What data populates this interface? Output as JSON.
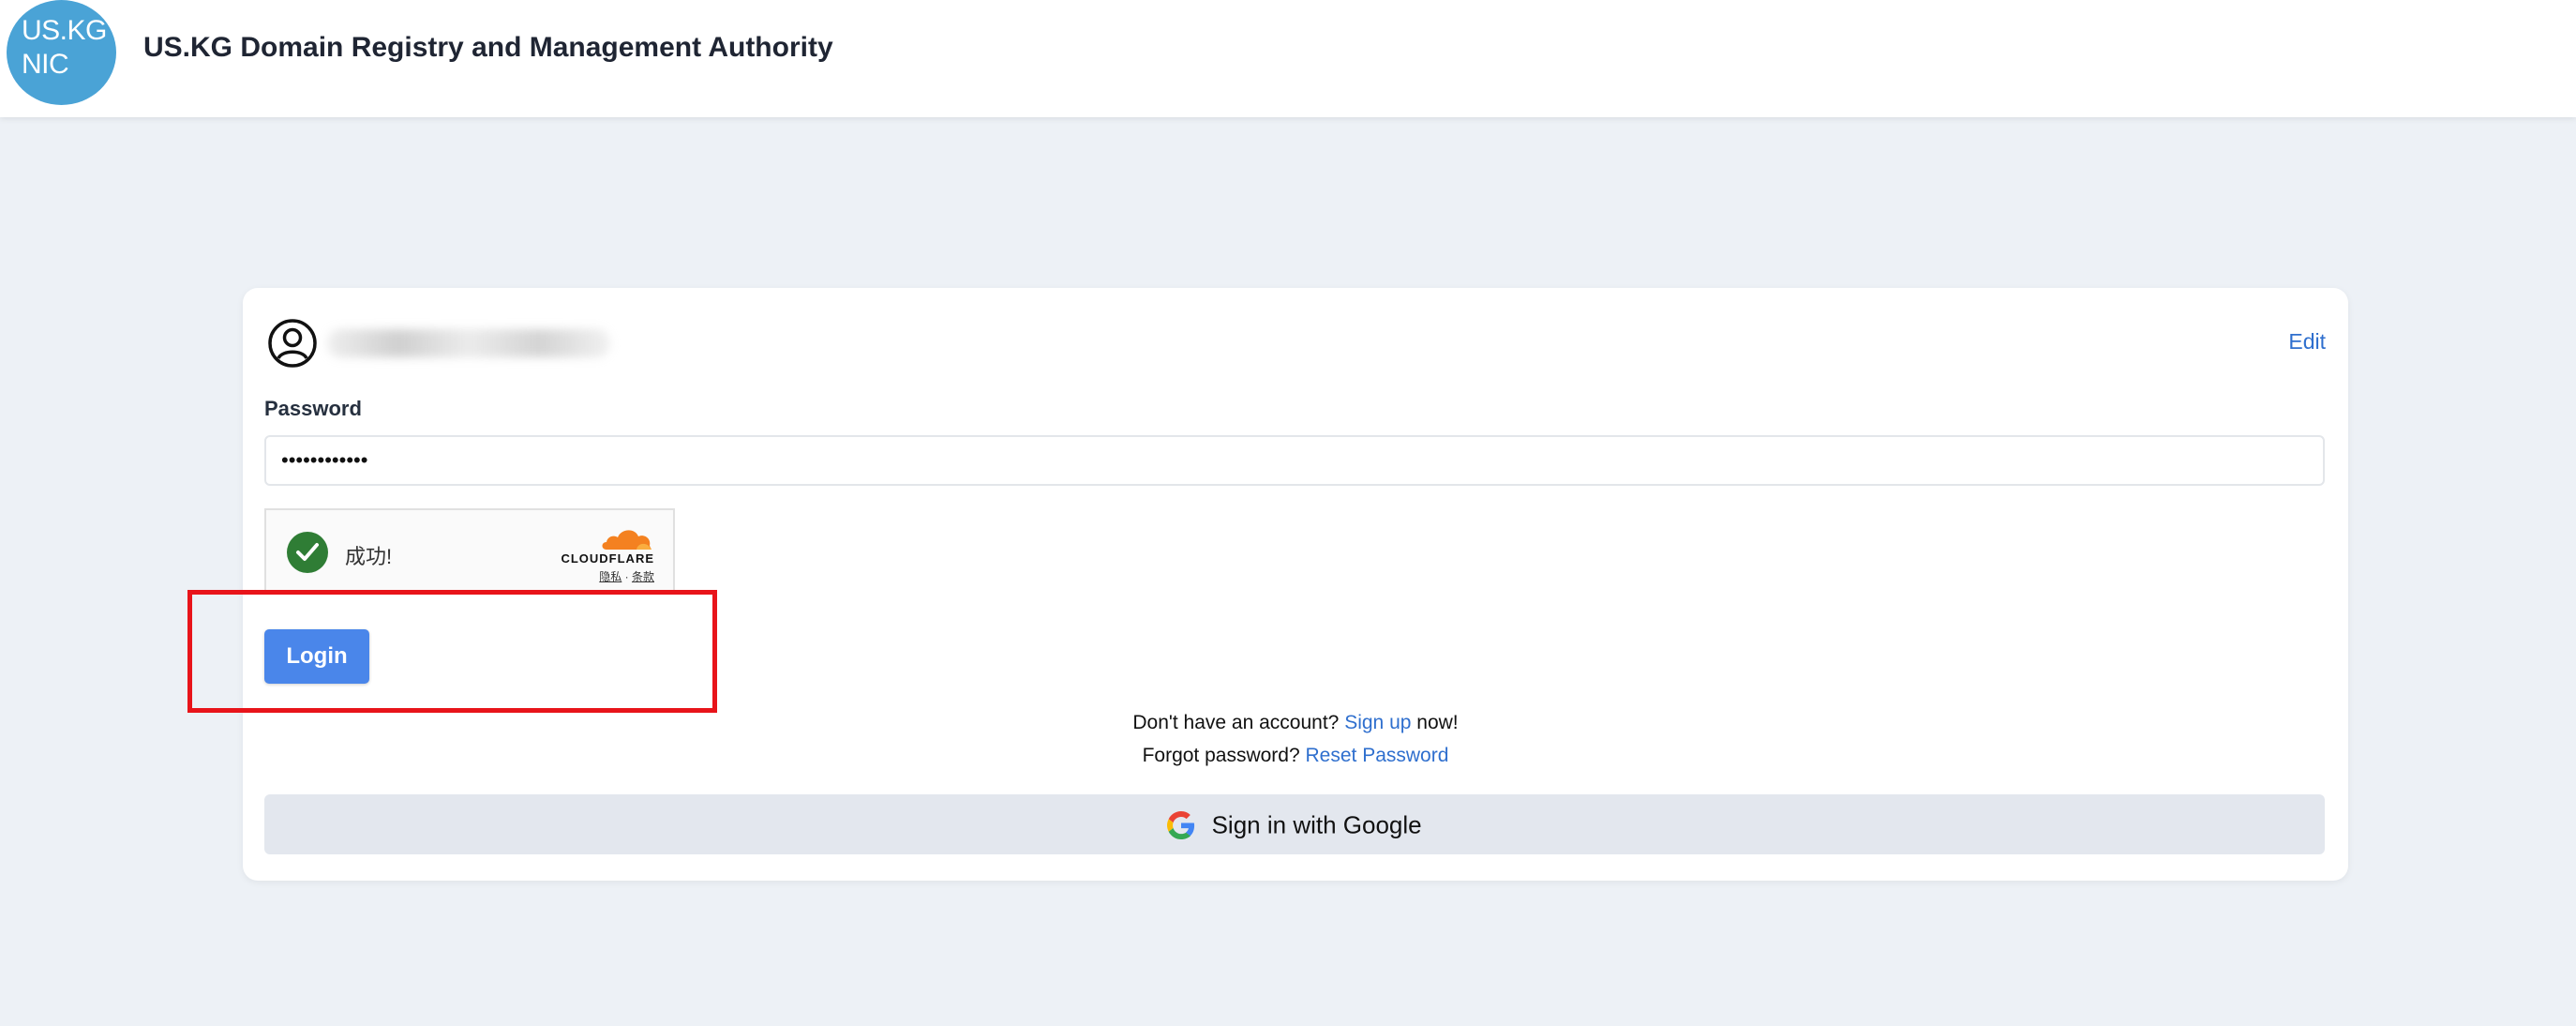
{
  "header": {
    "logo_line1": "US.KG",
    "logo_line2": "NIC",
    "title": "US.KG Domain Registry and Management Authority"
  },
  "login_card": {
    "edit_label": "Edit",
    "password_label": "Password",
    "password_value": "••••••••••••",
    "captcha": {
      "status_text": "成功!",
      "brand": "CLOUDFLARE",
      "privacy_link": "隐私",
      "separator": "·",
      "terms_link": "条款"
    },
    "login_label": "Login",
    "signup_prefix": "Don't have an account?",
    "signup_link": "Sign up",
    "signup_suffix": "now!",
    "forgot_prefix": "Forgot password?",
    "reset_link": "Reset Password",
    "google_label": "Sign in with Google"
  },
  "icons": [
    "user-circle-icon",
    "check-icon",
    "cloudflare-cloud-icon",
    "google-g-icon"
  ],
  "colors": {
    "background": "#edf1f6",
    "logo": "#4aa3d6",
    "primary_button": "#4a86ea",
    "link": "#2f6fce",
    "highlight": "#e8141a",
    "captcha_success": "#2f7d35"
  }
}
